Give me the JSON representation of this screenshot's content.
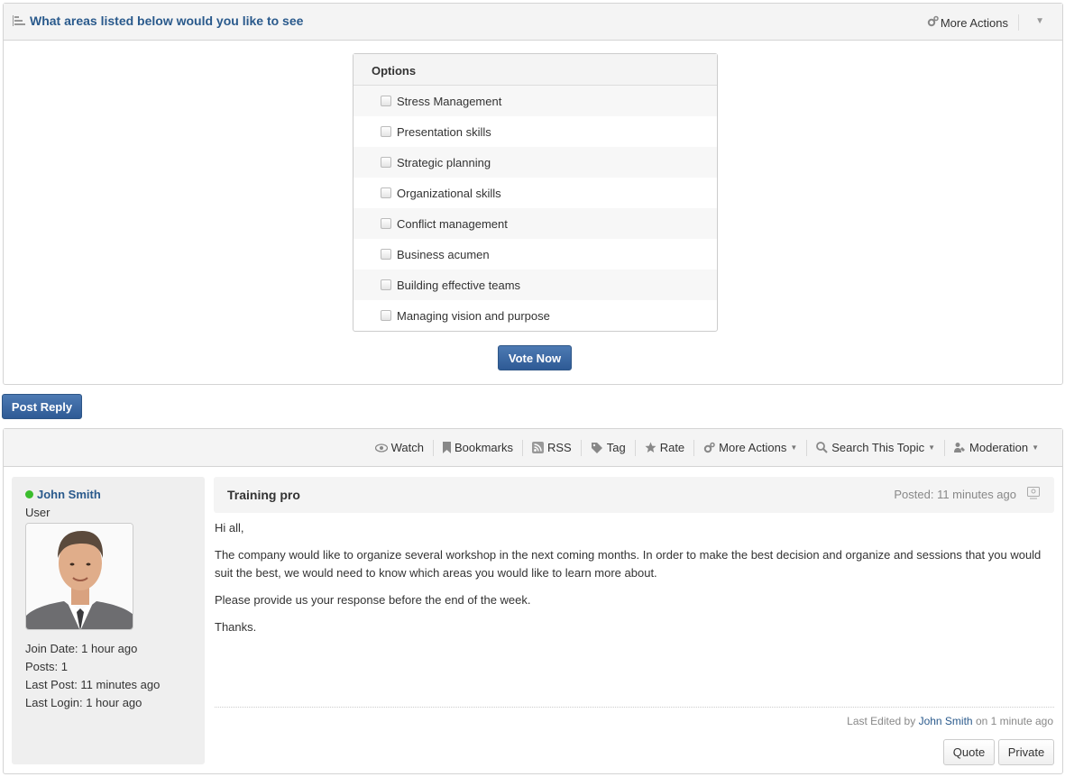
{
  "poll": {
    "title": "What areas listed below would you like to see",
    "more_actions": "More Actions",
    "options_header": "Options",
    "options": [
      "Stress Management",
      "Presentation skills",
      "Strategic planning",
      "Organizational skills",
      "Conflict management",
      "Business acumen",
      "Building effective teams",
      "Managing vision and purpose"
    ],
    "vote_label": "Vote Now"
  },
  "post_reply_label": "Post Reply",
  "toolbar": {
    "watch": "Watch",
    "bookmarks": "Bookmarks",
    "rss": "RSS",
    "tag": "Tag",
    "rate": "Rate",
    "more_actions": "More Actions",
    "search_topic": "Search This Topic",
    "moderation": "Moderation"
  },
  "author": {
    "name": "John Smith",
    "role": "User",
    "join_date": "Join Date: 1 hour ago",
    "posts": "Posts: 1",
    "last_post": "Last Post: 11 minutes ago",
    "last_login": "Last Login: 1 hour ago"
  },
  "post": {
    "title": "Training pro",
    "posted": "Posted: 11 minutes ago",
    "paragraphs": [
      "Hi all,",
      "The company would like to organize several workshop in the next coming months. In order to make the best decision and organize and sessions that you would suit the best, we would need to know which areas you would like to learn more about.",
      "Please provide us your response before the end of the week.",
      "Thanks."
    ],
    "last_edited_prefix": "Last Edited by",
    "last_edited_user": "John Smith",
    "last_edited_suffix": "on 1 minute ago",
    "quote_label": "Quote",
    "private_label": "Private"
  }
}
